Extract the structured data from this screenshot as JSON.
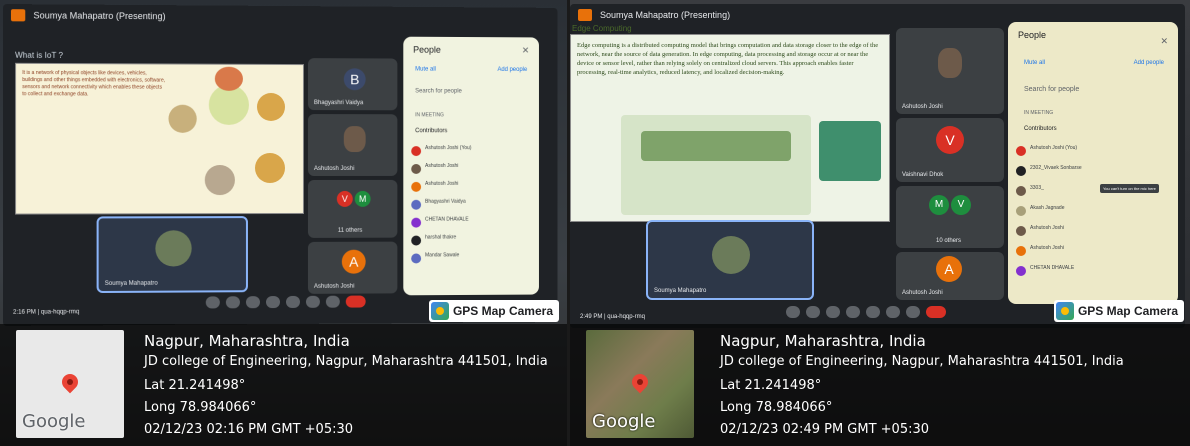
{
  "photos": [
    {
      "meeting_title": "Soumya Mahapatro (Presenting)",
      "slide_heading": "What is IoT ?",
      "slide_body": "It is a network of physical objects like devices, vehicles, buildings and other things embedded with electronics, software, sensors and network connectivity which enables these objects to collect and exchange data.",
      "tiles": [
        {
          "name": "Bhagyashri Vaidya",
          "initial": "B"
        },
        {
          "name": "Ashutosh Joshi",
          "initial": ""
        },
        {
          "name": "11 others",
          "initial": "V M"
        },
        {
          "name": "Ashutosh Joshi",
          "initial": "A"
        }
      ],
      "self_tile_name": "Soumya Mahapatro",
      "clock": "2:16 PM | qua-hqqp-rmq",
      "panel": {
        "title": "People",
        "mute_all": "Mute all",
        "add_people": "Add people",
        "search_placeholder": "Search for people",
        "section": "IN MEETING",
        "contributors": "Contributors",
        "participants": [
          "Ashutosh Joshi (You)",
          "Ashutosh Joshi",
          "Ashutosh Joshi",
          "Bhagyashri Vaidya",
          "CHETAN DHAVALE",
          "harshal thakre",
          "Mandar Sawale"
        ]
      },
      "gps": {
        "city": "Nagpur, Maharashtra, India",
        "address": "JD college of Engineering, Nagpur, Maharashtra 441501, India",
        "lat": "Lat 21.241498°",
        "long": "Long 78.984066°",
        "datetime": "02/12/23 02:16 PM GMT +05:30",
        "badge": "GPS Map Camera",
        "map_brand": "Google"
      }
    },
    {
      "meeting_title": "Soumya Mahapatro (Presenting)",
      "slide_heading": "Edge Computing",
      "slide_body": "Edge computing is a distributed computing model that brings computation and data storage closer to the edge of the network, near the source of data generation. In edge computing, data processing and storage occur at or near the device or sensor level, rather than relying solely on centralized cloud servers. This approach enables faster processing, real-time analytics, reduced latency, and localized decision-making.",
      "tiles": [
        {
          "name": "Ashutosh Joshi",
          "initial": ""
        },
        {
          "name": "Vaishnavi Dhok",
          "initial": "V"
        },
        {
          "name": "10 others",
          "initial": "M V"
        },
        {
          "name": "Ashutosh Joshi",
          "initial": "A"
        }
      ],
      "self_tile_name": "Soumya Mahapatro",
      "clock": "2:49 PM | qua-hqqp-rmq",
      "panel": {
        "title": "People",
        "mute_all": "Mute all",
        "add_people": "Add people",
        "search_placeholder": "Search for people",
        "section": "IN MEETING",
        "contributors": "Contributors",
        "tooltip": "You can't turn on the mic here",
        "participants": [
          "Ashutosh Joshi (You)",
          "2302_Vivaek Sonbarse",
          "3303_",
          "Akash Jagnade",
          "Ashutosh Joshi",
          "Ashutosh Joshi",
          "CHETAN DHAVALE"
        ]
      },
      "gps": {
        "city": "Nagpur, Maharashtra, India",
        "address": "JD college of Engineering, Nagpur, Maharashtra 441501, India",
        "lat": "Lat 21.241498°",
        "long": "Long 78.984066°",
        "datetime": "02/12/23 02:49 PM GMT +05:30",
        "badge": "GPS Map Camera",
        "map_brand": "Google"
      }
    }
  ],
  "colors": {
    "pin": "#ea4335",
    "meet_red": "#d93025",
    "avatar_green": "#1e8e3e",
    "avatar_orange": "#e8710a",
    "avatar_purple": "#8430ce"
  }
}
